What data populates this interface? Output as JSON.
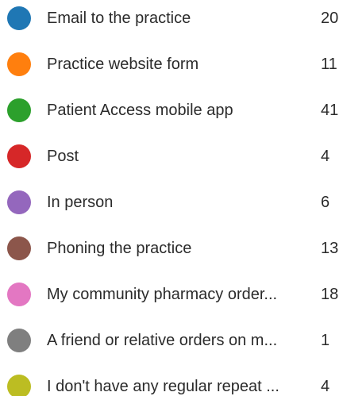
{
  "legend": {
    "items": [
      {
        "label": "Email to the practice",
        "value": "20",
        "color": "#1f77b4"
      },
      {
        "label": "Practice website form",
        "value": "11",
        "color": "#ff7f0e"
      },
      {
        "label": "Patient Access mobile app",
        "value": "41",
        "color": "#2ca02c"
      },
      {
        "label": "Post",
        "value": "4",
        "color": "#d62728"
      },
      {
        "label": "In person",
        "value": "6",
        "color": "#9467bd"
      },
      {
        "label": "Phoning the practice",
        "value": "13",
        "color": "#8c564b"
      },
      {
        "label": "My community pharmacy order...",
        "value": "18",
        "color": "#e377c2"
      },
      {
        "label": "A friend or relative orders on m...",
        "value": "1",
        "color": "#7f7f7f"
      },
      {
        "label": "I don't have any regular repeat ...",
        "value": "4",
        "color": "#bcbd22"
      }
    ]
  }
}
